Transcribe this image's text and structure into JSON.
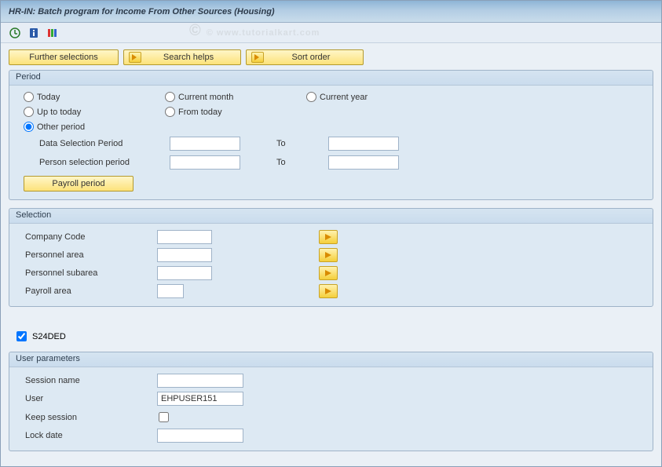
{
  "title": "HR-IN: Batch program for Income From Other Sources (Housing)",
  "watermark": "© www.tutorialkart.com",
  "buttons": {
    "further_selections": "Further selections",
    "search_helps": "Search helps",
    "sort_order": "Sort order",
    "payroll_period": "Payroll period"
  },
  "panels": {
    "period": "Period",
    "selection": "Selection",
    "user_params": "User parameters"
  },
  "period": {
    "today": "Today",
    "current_month": "Current month",
    "current_year": "Current year",
    "up_to_today": "Up to today",
    "from_today": "From today",
    "other_period": "Other period",
    "data_selection": "Data Selection Period",
    "person_selection": "Person selection period",
    "to": "To"
  },
  "selection": {
    "company_code": "Company Code",
    "personnel_area": "Personnel area",
    "personnel_subarea": "Personnel subarea",
    "payroll_area": "Payroll area"
  },
  "checkbox": {
    "s24ded": "S24DED"
  },
  "user_params": {
    "session_name": "Session name",
    "user": "User",
    "user_value": "EHPUSER151",
    "keep_session": "Keep session",
    "lock_date": "Lock date"
  }
}
